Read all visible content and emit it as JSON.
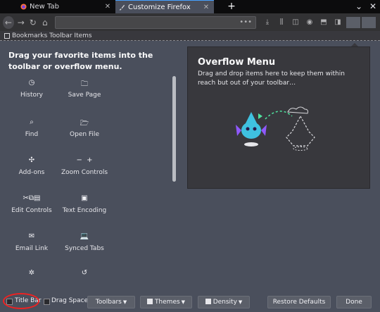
{
  "tabs": [
    {
      "title": "New Tab",
      "icon": "firefox-logo-icon",
      "selected": false
    },
    {
      "title": "Customize Firefox",
      "icon": "brush-icon",
      "selected": true
    }
  ],
  "bookmarks_label": "Bookmarks Toolbar Items",
  "palette": {
    "heading": "Drag your favorite items into the toolbar or overflow menu.",
    "items": [
      {
        "label": "History",
        "icon": "clock-icon"
      },
      {
        "label": "Save Page",
        "icon": "save-page-icon"
      },
      {
        "label": "Find",
        "icon": "search-icon"
      },
      {
        "label": "Open File",
        "icon": "folder-icon"
      },
      {
        "label": "Add-ons",
        "icon": "puzzle-icon"
      },
      {
        "label": "Zoom Controls",
        "icon": "zoom-icon"
      },
      {
        "label": "Edit Controls",
        "icon": "scissors-icon"
      },
      {
        "label": "Text Encoding",
        "icon": "text-encoding-icon"
      },
      {
        "label": "Email Link",
        "icon": "mail-icon"
      },
      {
        "label": "Synced Tabs",
        "icon": "laptop-icon"
      },
      {
        "label": "",
        "icon": "gear-icon"
      },
      {
        "label": "",
        "icon": "history-restore-icon"
      }
    ]
  },
  "overflow": {
    "title": "Overflow Menu",
    "description": "Drag and drop items here to keep them within reach but out of your toolbar…"
  },
  "footer": {
    "title_bar": "Title Bar",
    "drag_space": "Drag Space",
    "toolbars": "Toolbars",
    "themes": "Themes",
    "density": "Density",
    "restore_defaults": "Restore Defaults",
    "done": "Done"
  },
  "colors": {
    "accent": "#45a1ff",
    "annotation": "#ee2222"
  }
}
